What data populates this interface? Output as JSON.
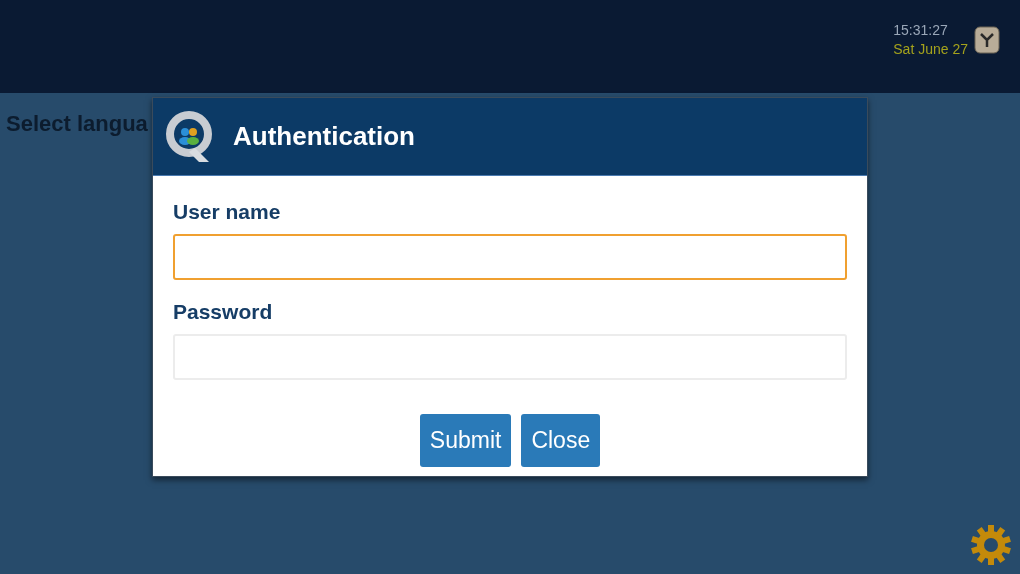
{
  "status": {
    "time": "15:31:27",
    "date": "Sat June 27"
  },
  "page": {
    "heading": "Select langua"
  },
  "dialog": {
    "title": "Authentication",
    "fields": [
      {
        "label": "User name",
        "focused": true
      },
      {
        "label": "Password",
        "focused": false
      }
    ],
    "buttons": [
      "Submit",
      "Close"
    ]
  }
}
